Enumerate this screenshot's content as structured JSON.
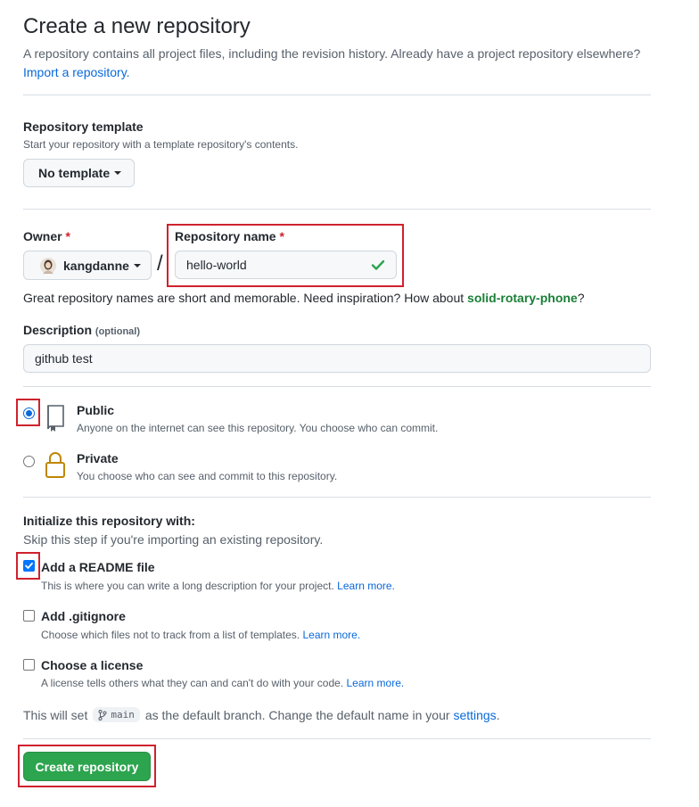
{
  "header": {
    "title": "Create a new repository",
    "lead": "A repository contains all project files, including the revision history. Already have a project repository elsewhere?",
    "import_link": "Import a repository."
  },
  "template": {
    "label": "Repository template",
    "note": "Start your repository with a template repository's contents.",
    "button": "No template"
  },
  "owner": {
    "label": "Owner",
    "required": "*",
    "value": "kangdanne"
  },
  "repo_name": {
    "label": "Repository name",
    "required": "*",
    "value": "hello-world",
    "separator": "/"
  },
  "suggestion": {
    "text": "Great repository names are short and memorable. Need inspiration? How about",
    "name": "solid-rotary-phone",
    "end": "?"
  },
  "description": {
    "label": "Description",
    "optional": "(optional)",
    "value": "github test"
  },
  "visibility": {
    "selected": "Public",
    "public": {
      "label": "Public",
      "note": "Anyone on the internet can see this repository. You choose who can commit."
    },
    "private": {
      "label": "Private",
      "note": "You choose who can see and commit to this repository."
    }
  },
  "init": {
    "label": "Initialize this repository with:",
    "note": "Skip this step if you're importing an existing repository.",
    "readme": {
      "label": "Add a README file",
      "checked": true,
      "note": "This is where you can write a long description for your project.",
      "link": "Learn more."
    },
    "gitignore": {
      "label": "Add .gitignore",
      "checked": false,
      "note": "Choose which files not to track from a list of templates.",
      "link": "Learn more."
    },
    "license": {
      "label": "Choose a license",
      "checked": false,
      "note": "A license tells others what they can and can't do with your code.",
      "link": "Learn more."
    }
  },
  "branch": {
    "prefix": "This will set",
    "name": "main",
    "suffix": "as the default branch. Change the default name in your",
    "link": "settings",
    "end": "."
  },
  "submit": {
    "label": "Create repository"
  },
  "colors": {
    "accent": "#0969da",
    "success": "#2da44e",
    "highlight": "#cf222e",
    "check": "#2da44e"
  }
}
